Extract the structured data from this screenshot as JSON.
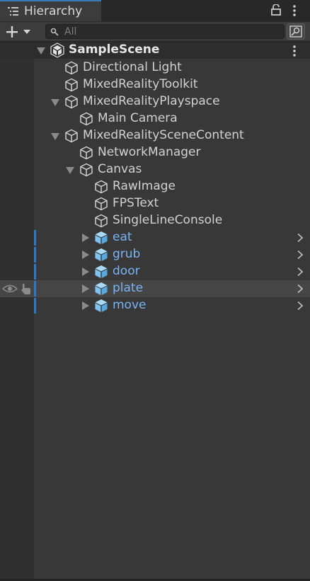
{
  "window": {
    "tab_title": "Hierarchy"
  },
  "toolbar": {
    "search_placeholder": "All"
  },
  "scene": {
    "name": "SampleScene"
  },
  "tree": [
    {
      "label": "Directional Light",
      "kind": "gameobject"
    },
    {
      "label": "MixedRealityToolkit",
      "kind": "gameobject"
    },
    {
      "label": "MixedRealityPlayspace",
      "kind": "gameobject",
      "expanded": true
    },
    {
      "label": "Main Camera",
      "kind": "gameobject"
    },
    {
      "label": "MixedRealitySceneContent",
      "kind": "gameobject",
      "expanded": true
    },
    {
      "label": "NetworkManager",
      "kind": "gameobject"
    },
    {
      "label": "Canvas",
      "kind": "gameobject",
      "expanded": true
    },
    {
      "label": "RawImage",
      "kind": "gameobject"
    },
    {
      "label": "FPSText",
      "kind": "gameobject"
    },
    {
      "label": "SingleLineConsole",
      "kind": "gameobject"
    },
    {
      "label": "eat",
      "kind": "prefab",
      "expanded": false
    },
    {
      "label": "grub",
      "kind": "prefab",
      "expanded": false
    },
    {
      "label": "door",
      "kind": "prefab",
      "expanded": false
    },
    {
      "label": "plate",
      "kind": "prefab",
      "expanded": false,
      "hovered": true
    },
    {
      "label": "move",
      "kind": "prefab",
      "expanded": false
    }
  ],
  "colors": {
    "background": "#383838",
    "prefab_text": "#7cb3f5",
    "prefab_icon": "#7fc4f0",
    "accent": "#2e78c4"
  }
}
